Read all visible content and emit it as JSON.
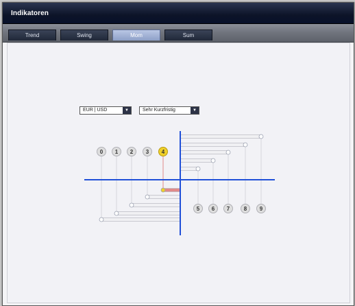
{
  "window": {
    "title": "Indikatoren"
  },
  "tabs": [
    {
      "label": "Trend",
      "active": false
    },
    {
      "label": "Swing",
      "active": false
    },
    {
      "label": "Mom",
      "active": true
    },
    {
      "label": "Sum",
      "active": false
    }
  ],
  "controls": {
    "pair_select": {
      "value": "EUR | USD"
    },
    "timeframe_select": {
      "value": "Sehr Kurzfristig"
    }
  },
  "indicator": {
    "left_markers": [
      "0",
      "1",
      "2",
      "3",
      "4"
    ],
    "right_markers": [
      "5",
      "6",
      "7",
      "8",
      "9"
    ],
    "highlighted_marker": "4",
    "colors": {
      "axis": "#1f4fd8",
      "marker_fill": "#dedede",
      "marker_highlight": "#f0d02a",
      "bar_fill": "#f0f0f3",
      "bar_highlight": "#e08a8a"
    }
  }
}
